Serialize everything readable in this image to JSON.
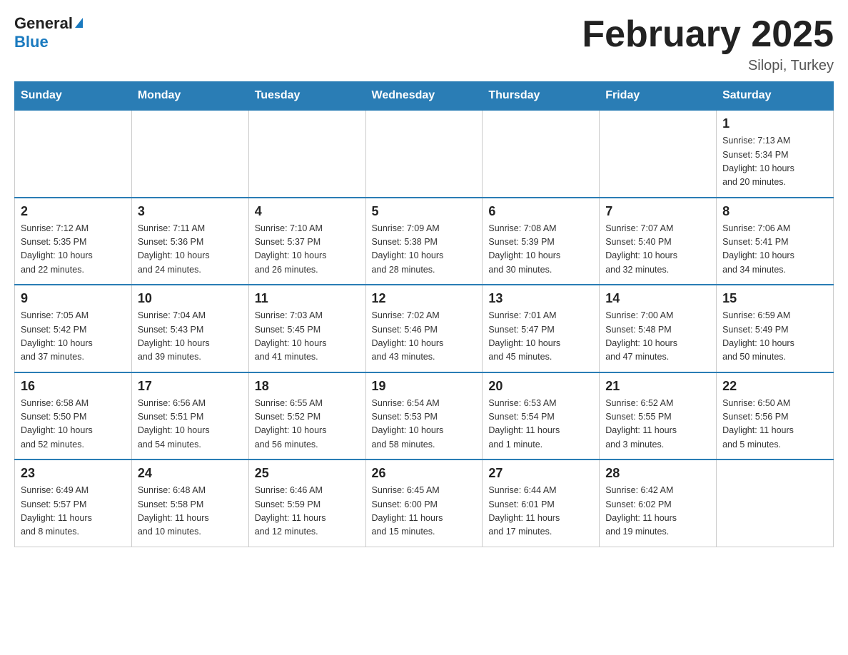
{
  "header": {
    "logo_general": "General",
    "logo_blue": "Blue",
    "month_title": "February 2025",
    "location": "Silopi, Turkey"
  },
  "weekdays": [
    "Sunday",
    "Monday",
    "Tuesday",
    "Wednesday",
    "Thursday",
    "Friday",
    "Saturday"
  ],
  "weeks": [
    [
      {
        "day": "",
        "info": ""
      },
      {
        "day": "",
        "info": ""
      },
      {
        "day": "",
        "info": ""
      },
      {
        "day": "",
        "info": ""
      },
      {
        "day": "",
        "info": ""
      },
      {
        "day": "",
        "info": ""
      },
      {
        "day": "1",
        "info": "Sunrise: 7:13 AM\nSunset: 5:34 PM\nDaylight: 10 hours\nand 20 minutes."
      }
    ],
    [
      {
        "day": "2",
        "info": "Sunrise: 7:12 AM\nSunset: 5:35 PM\nDaylight: 10 hours\nand 22 minutes."
      },
      {
        "day": "3",
        "info": "Sunrise: 7:11 AM\nSunset: 5:36 PM\nDaylight: 10 hours\nand 24 minutes."
      },
      {
        "day": "4",
        "info": "Sunrise: 7:10 AM\nSunset: 5:37 PM\nDaylight: 10 hours\nand 26 minutes."
      },
      {
        "day": "5",
        "info": "Sunrise: 7:09 AM\nSunset: 5:38 PM\nDaylight: 10 hours\nand 28 minutes."
      },
      {
        "day": "6",
        "info": "Sunrise: 7:08 AM\nSunset: 5:39 PM\nDaylight: 10 hours\nand 30 minutes."
      },
      {
        "day": "7",
        "info": "Sunrise: 7:07 AM\nSunset: 5:40 PM\nDaylight: 10 hours\nand 32 minutes."
      },
      {
        "day": "8",
        "info": "Sunrise: 7:06 AM\nSunset: 5:41 PM\nDaylight: 10 hours\nand 34 minutes."
      }
    ],
    [
      {
        "day": "9",
        "info": "Sunrise: 7:05 AM\nSunset: 5:42 PM\nDaylight: 10 hours\nand 37 minutes."
      },
      {
        "day": "10",
        "info": "Sunrise: 7:04 AM\nSunset: 5:43 PM\nDaylight: 10 hours\nand 39 minutes."
      },
      {
        "day": "11",
        "info": "Sunrise: 7:03 AM\nSunset: 5:45 PM\nDaylight: 10 hours\nand 41 minutes."
      },
      {
        "day": "12",
        "info": "Sunrise: 7:02 AM\nSunset: 5:46 PM\nDaylight: 10 hours\nand 43 minutes."
      },
      {
        "day": "13",
        "info": "Sunrise: 7:01 AM\nSunset: 5:47 PM\nDaylight: 10 hours\nand 45 minutes."
      },
      {
        "day": "14",
        "info": "Sunrise: 7:00 AM\nSunset: 5:48 PM\nDaylight: 10 hours\nand 47 minutes."
      },
      {
        "day": "15",
        "info": "Sunrise: 6:59 AM\nSunset: 5:49 PM\nDaylight: 10 hours\nand 50 minutes."
      }
    ],
    [
      {
        "day": "16",
        "info": "Sunrise: 6:58 AM\nSunset: 5:50 PM\nDaylight: 10 hours\nand 52 minutes."
      },
      {
        "day": "17",
        "info": "Sunrise: 6:56 AM\nSunset: 5:51 PM\nDaylight: 10 hours\nand 54 minutes."
      },
      {
        "day": "18",
        "info": "Sunrise: 6:55 AM\nSunset: 5:52 PM\nDaylight: 10 hours\nand 56 minutes."
      },
      {
        "day": "19",
        "info": "Sunrise: 6:54 AM\nSunset: 5:53 PM\nDaylight: 10 hours\nand 58 minutes."
      },
      {
        "day": "20",
        "info": "Sunrise: 6:53 AM\nSunset: 5:54 PM\nDaylight: 11 hours\nand 1 minute."
      },
      {
        "day": "21",
        "info": "Sunrise: 6:52 AM\nSunset: 5:55 PM\nDaylight: 11 hours\nand 3 minutes."
      },
      {
        "day": "22",
        "info": "Sunrise: 6:50 AM\nSunset: 5:56 PM\nDaylight: 11 hours\nand 5 minutes."
      }
    ],
    [
      {
        "day": "23",
        "info": "Sunrise: 6:49 AM\nSunset: 5:57 PM\nDaylight: 11 hours\nand 8 minutes."
      },
      {
        "day": "24",
        "info": "Sunrise: 6:48 AM\nSunset: 5:58 PM\nDaylight: 11 hours\nand 10 minutes."
      },
      {
        "day": "25",
        "info": "Sunrise: 6:46 AM\nSunset: 5:59 PM\nDaylight: 11 hours\nand 12 minutes."
      },
      {
        "day": "26",
        "info": "Sunrise: 6:45 AM\nSunset: 6:00 PM\nDaylight: 11 hours\nand 15 minutes."
      },
      {
        "day": "27",
        "info": "Sunrise: 6:44 AM\nSunset: 6:01 PM\nDaylight: 11 hours\nand 17 minutes."
      },
      {
        "day": "28",
        "info": "Sunrise: 6:42 AM\nSunset: 6:02 PM\nDaylight: 11 hours\nand 19 minutes."
      },
      {
        "day": "",
        "info": ""
      }
    ]
  ]
}
